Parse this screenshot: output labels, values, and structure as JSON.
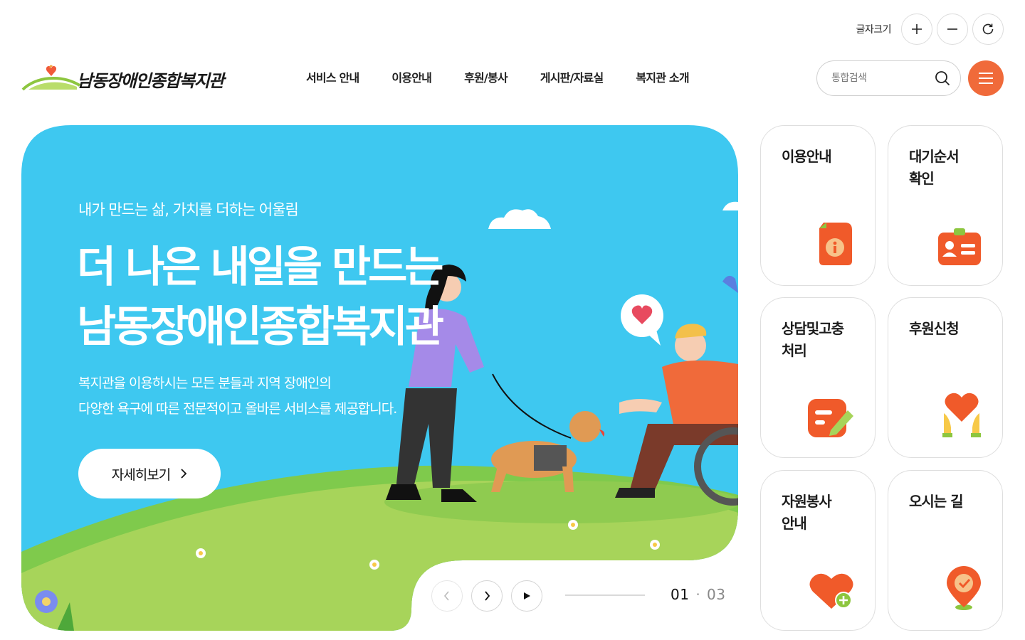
{
  "utility": {
    "font_size_label": "글자크기",
    "icons": [
      "plus-icon",
      "minus-icon",
      "refresh-icon"
    ]
  },
  "header": {
    "logo_text": "남동장애인종합복지관",
    "nav": [
      "서비스 안내",
      "이용안내",
      "후원/봉사",
      "게시판/자료실",
      "복지관 소개"
    ],
    "search_placeholder": "통합검색",
    "accent_color": "#f06a3a"
  },
  "hero": {
    "subtitle": "내가 만드는 삶, 가치를 더하는 어울림",
    "title_line1": "더 나은 내일을 만드는",
    "title_line2": "남동장애인종합복지관",
    "desc_line1": "복지관을 이용하시는 모든 분들과 지역 장애인의",
    "desc_line2": "다양한 욕구에 따른 전문적이고 올바른 서비스를 제공합니다.",
    "more_label": "자세히보기",
    "background_color": "#3ec8f0",
    "pager_current": "01",
    "pager_sep": "·",
    "pager_total": "03"
  },
  "tiles": [
    {
      "label": "이용안내",
      "icon": "info-document-icon"
    },
    {
      "label": "대기순서\n확인",
      "icon": "id-card-icon"
    },
    {
      "label": "상담및고충\n처리",
      "icon": "edit-note-icon"
    },
    {
      "label": "후원신청",
      "icon": "heart-hands-icon"
    },
    {
      "label": "자원봉사\n안내",
      "icon": "heart-plus-icon"
    },
    {
      "label": "오시는 길",
      "icon": "location-pin-icon"
    }
  ]
}
